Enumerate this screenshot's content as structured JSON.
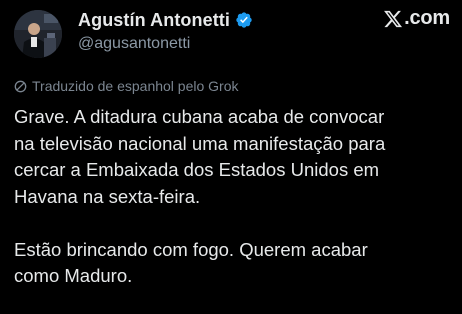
{
  "author": {
    "display_name": "Agustín Antonetti",
    "handle": "@agusantonetti",
    "verified_icon": "verified-badge-icon",
    "verified_color": "#1d9bf0"
  },
  "brand": {
    "logo_icon": "x-logo-icon",
    "suffix": ".com"
  },
  "translation": {
    "icon": "translate-icon",
    "label": "Traduzido de espanhol pelo Grok"
  },
  "tweet": {
    "paragraph_1": [
      "Grave. A ditadura cubana acaba de convocar",
      "na televisão nacional uma manifestação para",
      "cercar a Embaixada dos Estados Unidos em",
      "Havana na sexta-feira."
    ],
    "paragraph_2": [
      "Estão brincando com fogo. Querem acabar",
      "como Maduro."
    ]
  },
  "colors": {
    "background": "#000000",
    "text_primary": "#e7e9ea",
    "text_secondary": "#8b98a5",
    "accent": "#1d9bf0"
  }
}
